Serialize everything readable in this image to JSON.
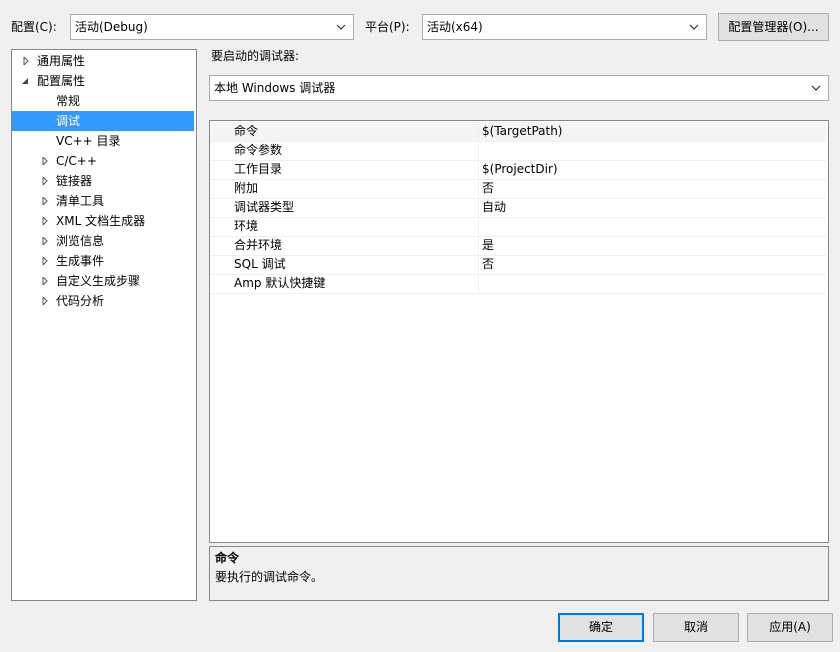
{
  "toolbar": {
    "config_label": "配置(C):",
    "config_value": "活动(Debug)",
    "platform_label": "平台(P):",
    "platform_value": "活动(x64)",
    "config_manager_button": "配置管理器(O)..."
  },
  "tree": {
    "items": [
      {
        "label": "通用属性"
      },
      {
        "label": "配置属性"
      },
      {
        "label": "常规"
      },
      {
        "label": "调试"
      },
      {
        "label": "VC++ 目录"
      },
      {
        "label": "C/C++"
      },
      {
        "label": "链接器"
      },
      {
        "label": "清单工具"
      },
      {
        "label": "XML 文档生成器"
      },
      {
        "label": "浏览信息"
      },
      {
        "label": "生成事件"
      },
      {
        "label": "自定义生成步骤"
      },
      {
        "label": "代码分析"
      }
    ],
    "selected": "调试"
  },
  "debugger": {
    "label": "要启动的调试器:",
    "value": "本地 Windows 调试器"
  },
  "properties": {
    "rows": [
      {
        "name": "命令",
        "value": "$(TargetPath)"
      },
      {
        "name": "命令参数",
        "value": ""
      },
      {
        "name": "工作目录",
        "value": "$(ProjectDir)"
      },
      {
        "name": "附加",
        "value": "否"
      },
      {
        "name": "调试器类型",
        "value": "自动"
      },
      {
        "name": "环境",
        "value": ""
      },
      {
        "name": "合并环境",
        "value": "是"
      },
      {
        "name": "SQL 调试",
        "value": "否"
      },
      {
        "name": "Amp 默认快捷键",
        "value": ""
      }
    ]
  },
  "description": {
    "title": "命令",
    "text": "要执行的调试命令。"
  },
  "buttons": {
    "ok": "确定",
    "cancel": "取消",
    "apply": "应用(A)"
  },
  "colors": {
    "selection": "#3399ff",
    "default_button_border": "#0078d7"
  }
}
